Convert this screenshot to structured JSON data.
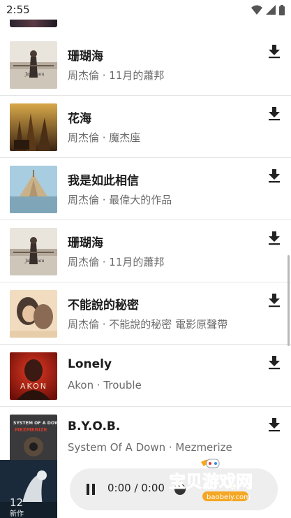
{
  "status_bar": {
    "time": "2:55"
  },
  "songs": [
    {
      "title": "珊瑚海",
      "subtitle": "周杰倫 · 11月的蕭邦",
      "cover": "cover-11yue"
    },
    {
      "title": "花海",
      "subtitle": "周杰倫 · 魔杰座",
      "cover": "cover-mojiezuo"
    },
    {
      "title": "我是如此相信",
      "subtitle": "周杰倫 · 最偉大的作品",
      "cover": "cover-zuiweida"
    },
    {
      "title": "珊瑚海",
      "subtitle": "周杰倫 · 11月的蕭邦",
      "cover": "cover-11yue"
    },
    {
      "title": "不能說的秘密",
      "subtitle": "周杰倫 · 不能說的秘密 電影原聲帶",
      "cover": "cover-secret"
    },
    {
      "title": "Lonely",
      "subtitle": "Akon · Trouble",
      "cover": "cover-trouble"
    },
    {
      "title": "B.Y.O.B.",
      "subtitle": "System Of A Down · Mezmerize",
      "cover": "cover-mezmerize"
    }
  ],
  "player": {
    "time_readout": "0:00 / 0:00",
    "state": "playing",
    "progress": 0
  },
  "watermark": {
    "text": "宝贝游戏网",
    "url_text": "baobeiy.com"
  },
  "colors": {
    "accent": "#222222",
    "divider": "#e4e4e4",
    "pill": "#eeeeef",
    "watermark": "#f5a623"
  },
  "icons": {
    "download": "download-icon",
    "pause": "pause-icon",
    "wifi": "wifi-icon",
    "signal": "signal-icon",
    "battery": "battery-icon"
  }
}
